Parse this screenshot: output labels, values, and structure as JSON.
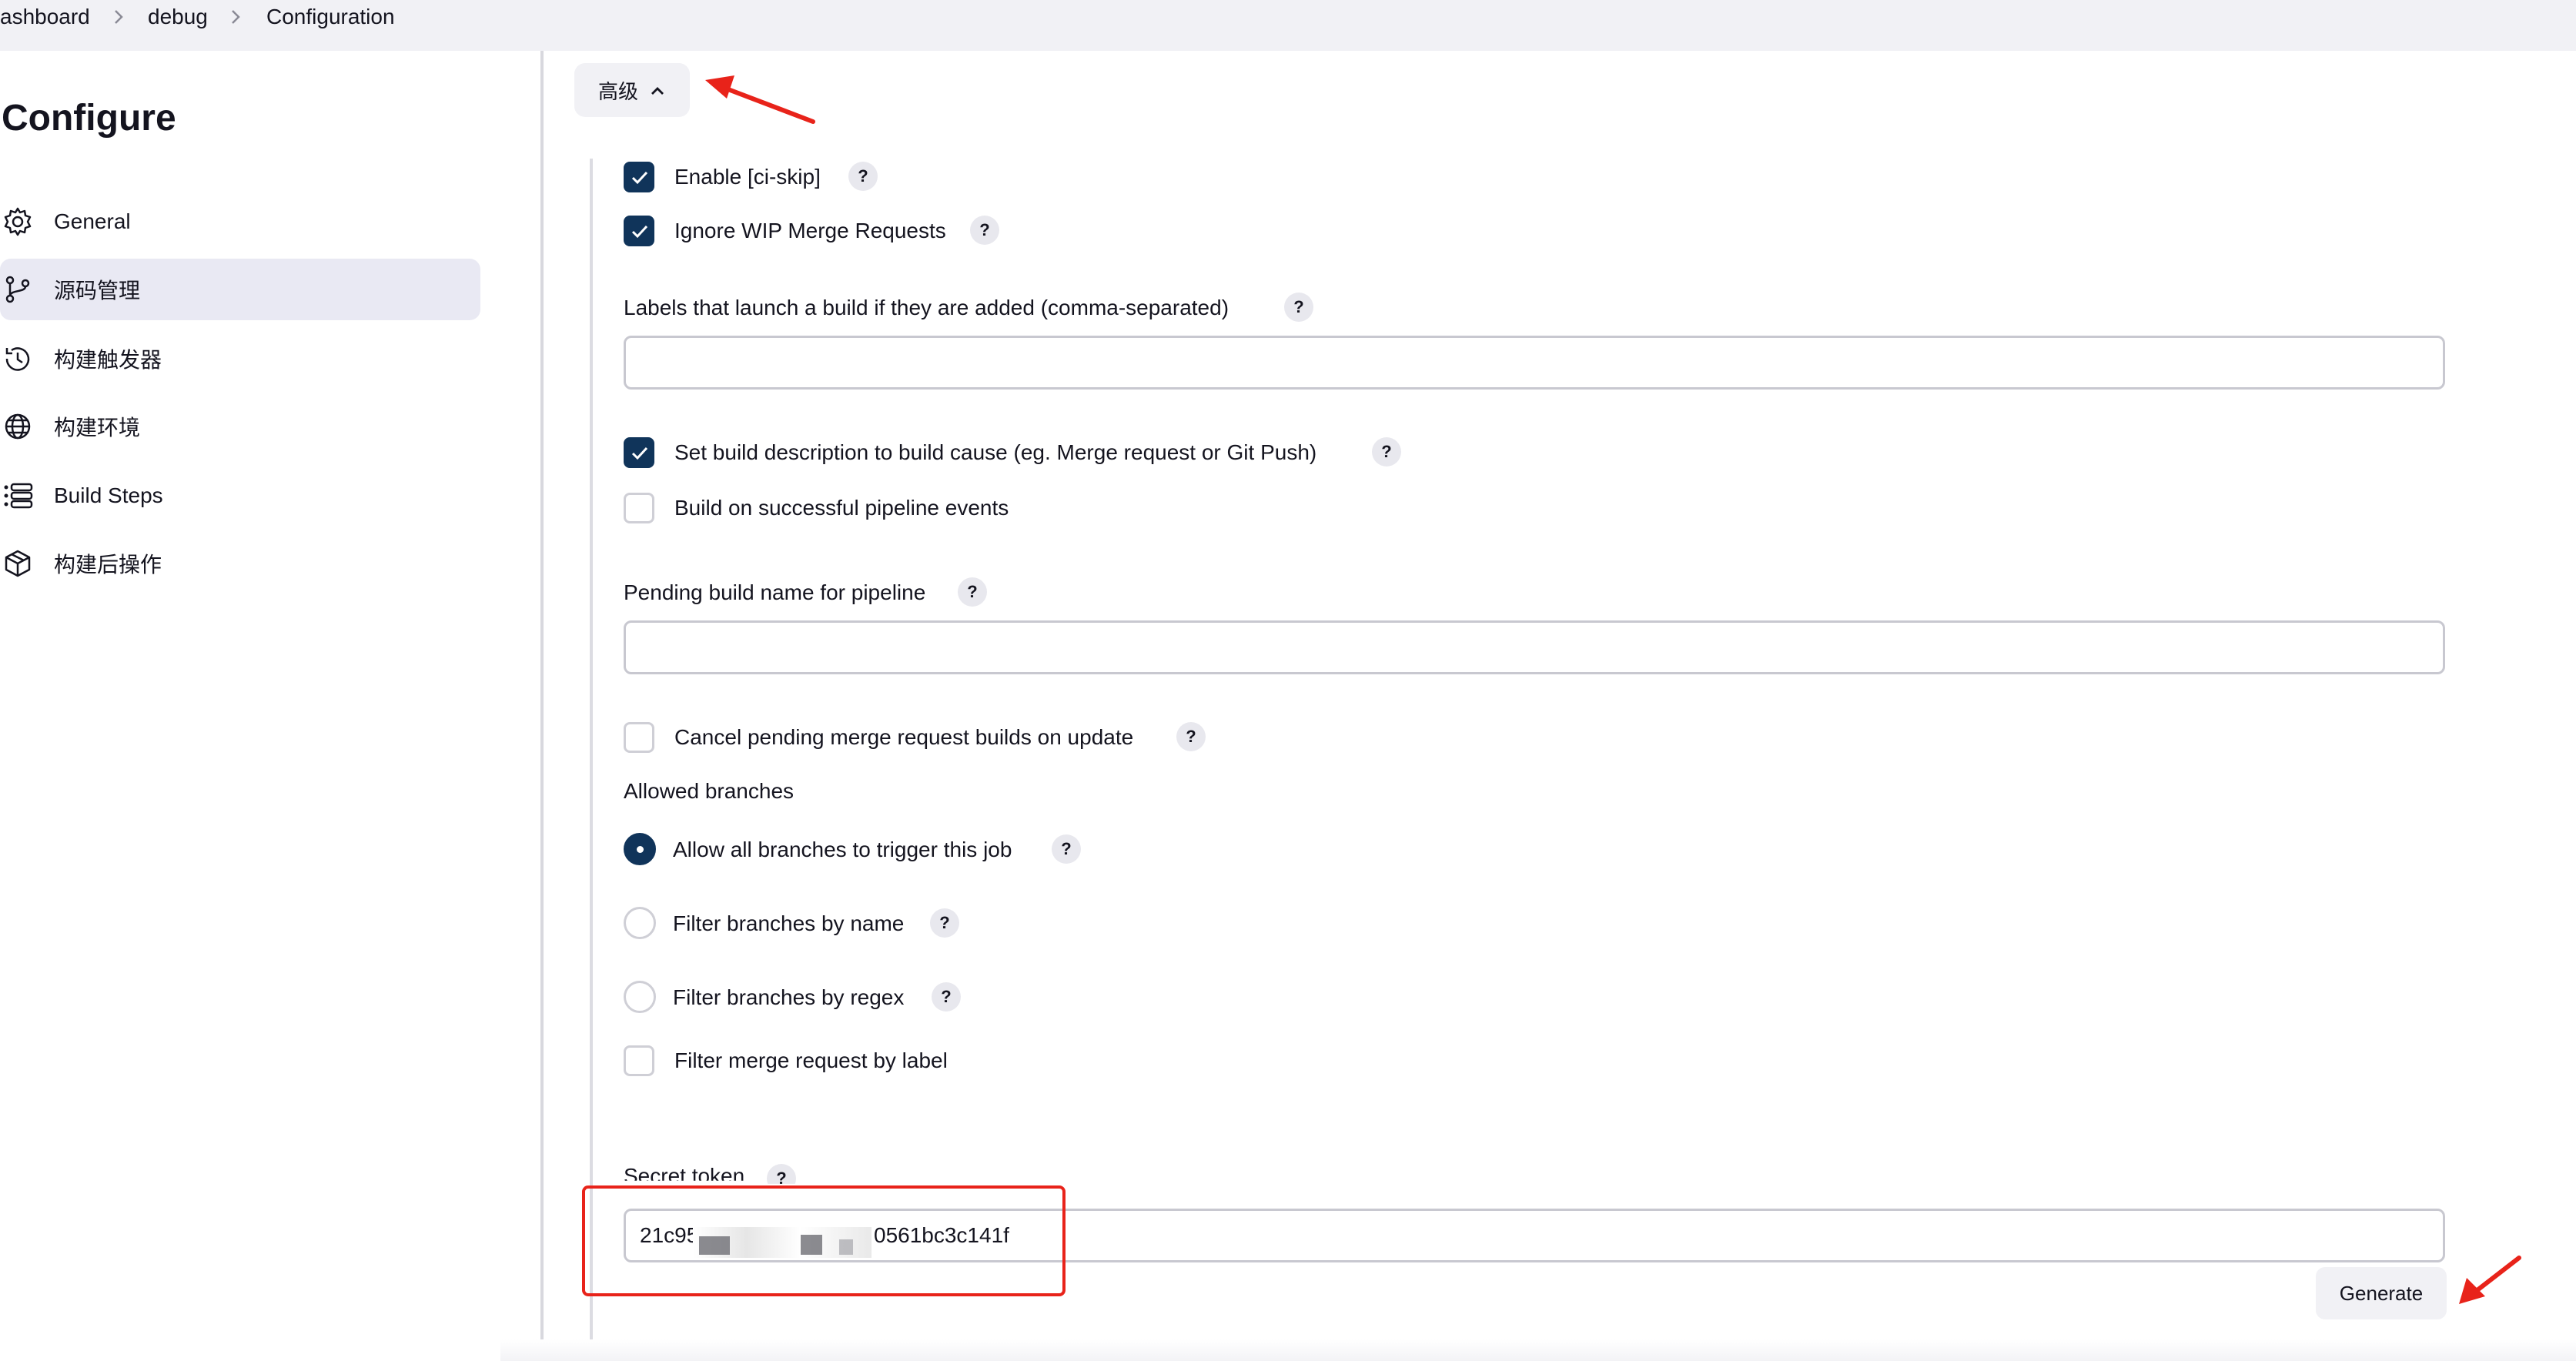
{
  "breadcrumb": {
    "items": [
      "ashboard",
      "debug",
      "Configuration"
    ]
  },
  "sidebar": {
    "title": "Configure",
    "items": [
      {
        "label": "General",
        "icon": "gear-icon",
        "active": false
      },
      {
        "label": "源码管理",
        "icon": "branch-icon",
        "active": true
      },
      {
        "label": "构建触发器",
        "icon": "clock-icon",
        "active": false
      },
      {
        "label": "构建环境",
        "icon": "globe-icon",
        "active": false
      },
      {
        "label": "Build Steps",
        "icon": "list-icon",
        "active": false
      },
      {
        "label": "构建后操作",
        "icon": "package-icon",
        "active": false
      }
    ]
  },
  "advanced": {
    "label": "高级",
    "icon": "chevron-up-icon",
    "expanded": true
  },
  "form": {
    "enable_ci_skip": {
      "label": "Enable [ci-skip]",
      "checked": true,
      "help": "?"
    },
    "ignore_wip": {
      "label": "Ignore WIP Merge Requests",
      "checked": true,
      "help": "?"
    },
    "labels_launch": {
      "label": "Labels that launch a build if they are added (comma-separated)",
      "value": "",
      "help": "?"
    },
    "set_build_desc": {
      "label": "Set build description to build cause (eg. Merge request or Git Push)",
      "checked": true,
      "help": "?"
    },
    "build_on_pipeline": {
      "label": "Build on successful pipeline events",
      "checked": false
    },
    "pending_build_name": {
      "label": "Pending build name for pipeline",
      "value": "",
      "help": "?"
    },
    "cancel_pending": {
      "label": "Cancel pending merge request builds on update",
      "checked": false,
      "help": "?"
    },
    "allowed_branches": {
      "label": "Allowed branches",
      "options": [
        {
          "label": "Allow all branches to trigger this job",
          "selected": true,
          "help": "?"
        },
        {
          "label": "Filter branches by name",
          "selected": false,
          "help": "?"
        },
        {
          "label": "Filter branches by regex",
          "selected": false,
          "help": "?"
        }
      ]
    },
    "filter_mr_label": {
      "label": "Filter merge request by label",
      "checked": false
    },
    "secret_token": {
      "label": "Secret token",
      "value_start": "21c95",
      "value_end": "0561bc3c141f",
      "help": "?"
    },
    "generate_label": "Generate"
  },
  "colors": {
    "accent": "#10345a",
    "annotation": "#e8231a",
    "sidebar_active_bg": "#e9e9f3"
  }
}
